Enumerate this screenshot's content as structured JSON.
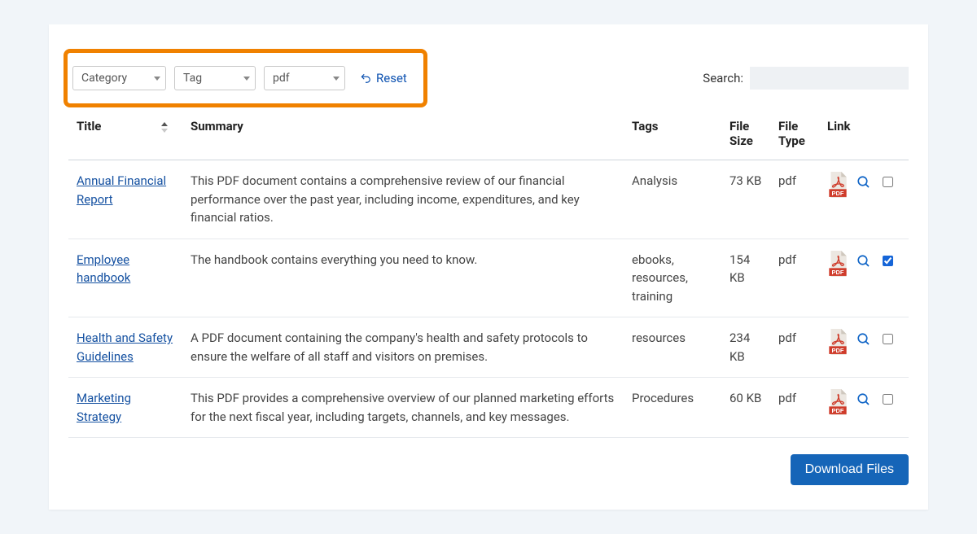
{
  "filters": {
    "category": "Category",
    "tag": "Tag",
    "filetype": "pdf",
    "reset": "Reset"
  },
  "search": {
    "label": "Search:",
    "value": ""
  },
  "columns": {
    "title": "Title",
    "summary": "Summary",
    "tags": "Tags",
    "size": "File Size",
    "type": "File Type",
    "link": "Link"
  },
  "rows": [
    {
      "title": "Annual Financial Report",
      "summary": "This PDF document contains a comprehensive review of our financial performance over the past year, including income, expenditures, and key financial ratios.",
      "tags": "Analysis",
      "size": "73 KB",
      "type": "pdf",
      "checked": false
    },
    {
      "title": "Employee handbook",
      "summary": "The handbook contains everything you need to know.",
      "tags": "ebooks, resources, training",
      "size": "154 KB",
      "type": "pdf",
      "checked": true
    },
    {
      "title": "Health and Safety Guidelines",
      "summary": "A PDF document containing the company's health and safety protocols to ensure the welfare of all staff and visitors on premises.",
      "tags": "resources",
      "size": "234 KB",
      "type": "pdf",
      "checked": false
    },
    {
      "title": "Marketing Strategy",
      "summary": "This PDF provides a comprehensive overview of our planned marketing efforts for the next fiscal year, including targets, channels, and key messages.",
      "tags": "Procedures",
      "size": "60 KB",
      "type": "pdf",
      "checked": false
    }
  ],
  "download_button": "Download Files"
}
